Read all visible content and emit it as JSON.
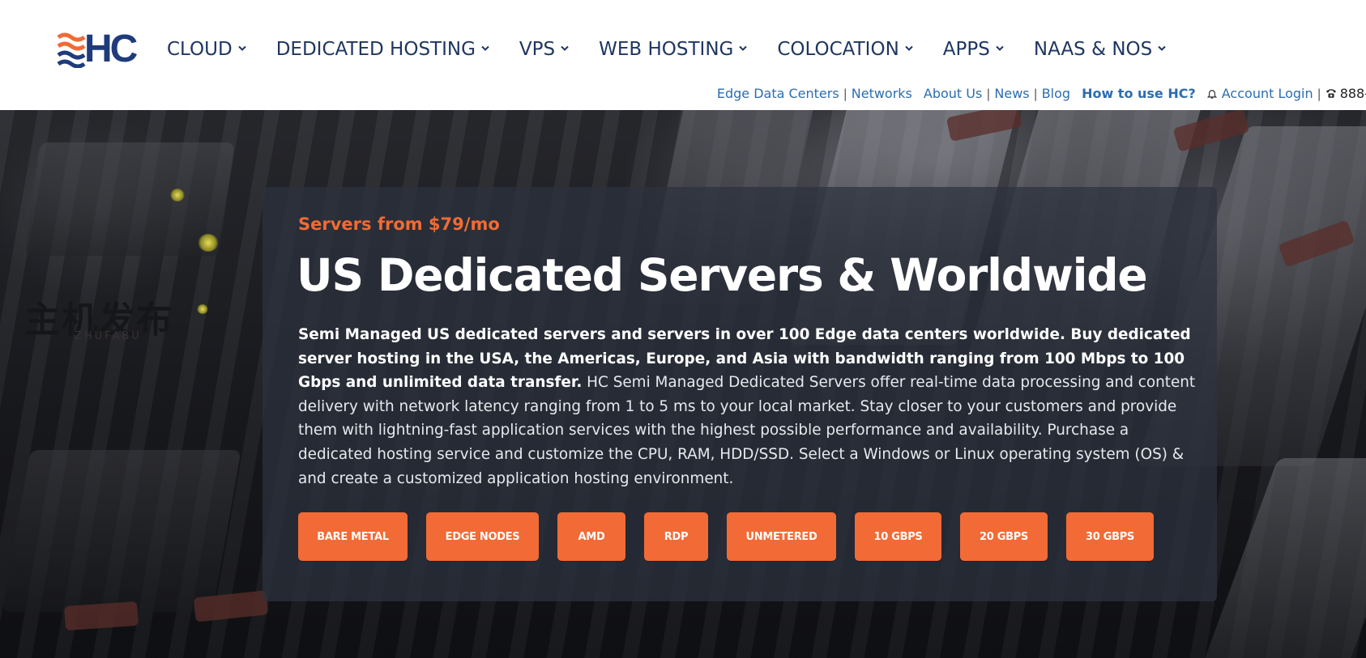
{
  "header": {
    "logo_text": "HC",
    "nav": [
      {
        "label": "CLOUD"
      },
      {
        "label": "DEDICATED HOSTING"
      },
      {
        "label": "VPS"
      },
      {
        "label": "WEB HOSTING"
      },
      {
        "label": "COLOCATION"
      },
      {
        "label": "APPS"
      },
      {
        "label": "NAAS & NOS"
      }
    ],
    "subnav": {
      "edge": "Edge Data Centers",
      "networks": "Networks",
      "about": "About Us",
      "news": "News",
      "blog": "Blog",
      "howto": "How to use HC?",
      "login": "Account Login",
      "phone": "888-"
    }
  },
  "watermark": {
    "cn": "主机发布",
    "en": "ZHUFABU"
  },
  "hero": {
    "eyebrow": "Servers from $79/mo",
    "headline": "US Dedicated Servers & Worldwide",
    "desc_bold": "Semi Managed US dedicated servers and servers in over 100 Edge data centers worldwide. Buy dedicated server hosting in the USA, the Americas, Europe, and Asia with bandwidth ranging from 100 Mbps to 100 Gbps and unlimited data transfer.",
    "desc_rest": " HC Semi Managed Dedicated Servers offer real-time data processing and content delivery with network latency ranging from 1 to 5 ms to your local market. Stay closer to your customers and provide them with lightning-fast application services with the highest possible performance and availability. Purchase a dedicated hosting service and customize the CPU, RAM, HDD/SSD. Select a Windows or Linux operating system (OS) & and create a customized application hosting environment.",
    "buttons": [
      {
        "label": "BARE METAL"
      },
      {
        "label": "EDGE NODES"
      },
      {
        "label": "AMD"
      },
      {
        "label": "RDP"
      },
      {
        "label": "UNMETERED"
      },
      {
        "label": "10 GBPS"
      },
      {
        "label": "20 GBPS"
      },
      {
        "label": "30 GBPS"
      }
    ]
  },
  "colors": {
    "accent_orange": "#f26a36",
    "nav_text": "#1f3660",
    "link_blue": "#2d6db0",
    "logo_blue": "#1f3b7c"
  }
}
